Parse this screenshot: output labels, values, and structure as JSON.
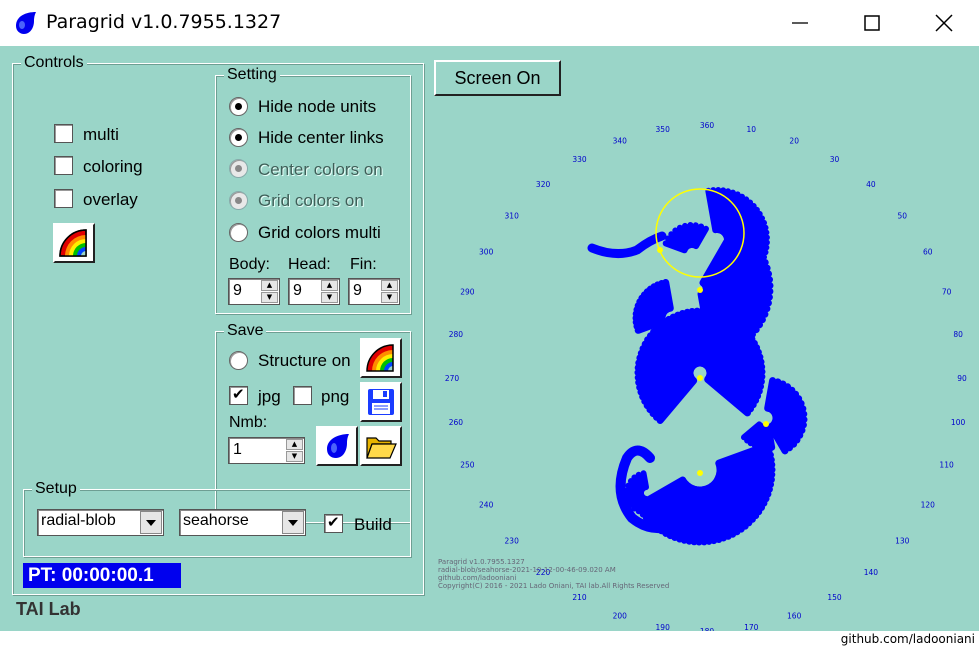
{
  "window": {
    "title": "Paragrid v1.0.7955.1327",
    "minimize_icon": "minimize-icon",
    "maximize_icon": "maximize-icon",
    "close_icon": "close-icon",
    "app_icon": "drop-icon"
  },
  "controls": {
    "title": "Controls",
    "checkboxes": [
      {
        "label": "multi",
        "checked": false
      },
      {
        "label": "coloring",
        "checked": false
      },
      {
        "label": "overlay",
        "checked": false
      }
    ],
    "palette_button_icon": "rainbow-icon"
  },
  "setting": {
    "title": "Setting",
    "radios": [
      {
        "label": "Hide node units",
        "checked": true,
        "enabled": true
      },
      {
        "label": "Hide center links",
        "checked": true,
        "enabled": true
      },
      {
        "label": "Center colors on",
        "checked": true,
        "enabled": false
      },
      {
        "label": "Grid colors on",
        "checked": true,
        "enabled": false
      },
      {
        "label": "Grid colors multi",
        "checked": false,
        "enabled": true
      }
    ],
    "body_label": "Body:",
    "head_label": "Head:",
    "fin_label": "Fin:",
    "body_value": "9",
    "head_value": "9",
    "fin_value": "9"
  },
  "save": {
    "title": "Save",
    "structure_label": "Structure on",
    "jpg_label": "jpg",
    "jpg_checked": true,
    "png_label": "png",
    "png_checked": false,
    "nmb_label": "Nmb:",
    "nmb_value": "1",
    "icons": [
      "rainbow-icon",
      "floppy-disk-icon",
      "drop-icon",
      "folder-icon"
    ]
  },
  "setup": {
    "title": "Setup",
    "mode_value": "radial-blob",
    "shape_value": "seahorse",
    "build_label": "Build",
    "build_checked": true
  },
  "status": {
    "pt_text": "PT: 00:00:00.1",
    "lab_text": "TAI Lab"
  },
  "canvas": {
    "screen_button": "Screen On",
    "angles": [
      "360",
      "10",
      "20",
      "30",
      "40",
      "50",
      "60",
      "70",
      "80",
      "90",
      "100",
      "110",
      "120",
      "130",
      "140",
      "150",
      "160",
      "170",
      "180",
      "190",
      "200",
      "210",
      "220",
      "230",
      "240",
      "250",
      "260",
      "270",
      "280",
      "290",
      "300",
      "310",
      "320",
      "330",
      "340",
      "350"
    ],
    "credits": [
      "Paragrid v1.0.7955.1327",
      "radial-blob/seahorse-2021-10-12-00-46-09.020 AM",
      "github.com/ladooniani",
      "Copyright(C) 2016 - 2021 Lado Oniani, TAI lab.All Rights Reserved"
    ],
    "blob_color": "#0000ff",
    "center_color": "#ffff00",
    "angle_color": "#0000cc"
  },
  "footer": {
    "text": "github.com/ladooniani"
  }
}
